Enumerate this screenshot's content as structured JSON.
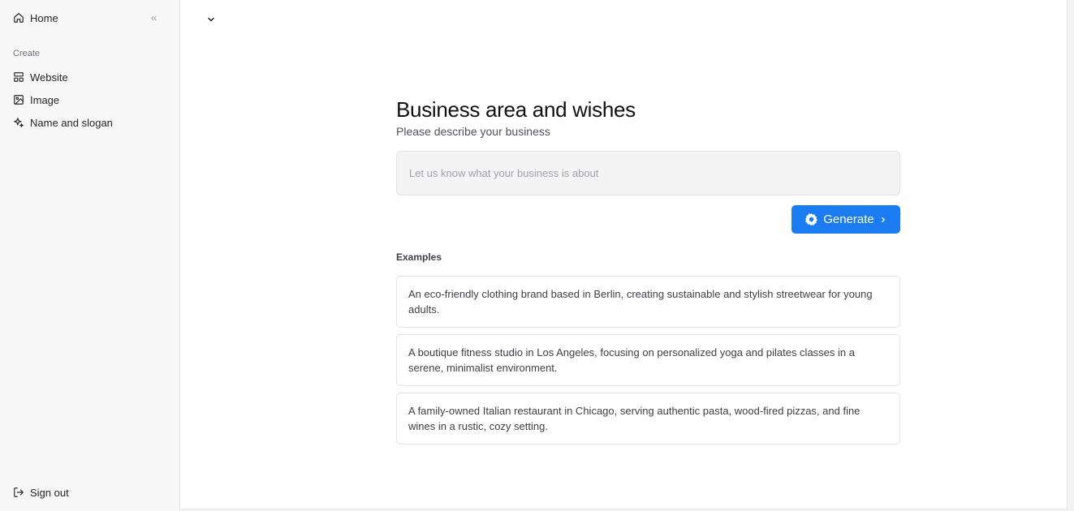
{
  "sidebar": {
    "home_label": "Home",
    "section_label": "Create",
    "items": [
      {
        "label": "Website",
        "icon": "layout-icon"
      },
      {
        "label": "Image",
        "icon": "image-icon"
      },
      {
        "label": "Name and slogan",
        "icon": "sparkle-icon"
      }
    ],
    "sign_out_label": "Sign out"
  },
  "main": {
    "title": "Business area and wishes",
    "subtitle": "Please describe your business",
    "input": {
      "value": "",
      "placeholder": "Let us know what your business is about"
    },
    "generate_label": "Generate",
    "examples_label": "Examples",
    "examples": [
      "An eco-friendly clothing brand based in Berlin, creating sustainable and stylish streetwear for young adults.",
      "A boutique fitness studio in Los Angeles, focusing on personalized yoga and pilates classes in a serene, minimalist environment.",
      "A family-owned Italian restaurant in Chicago, serving authentic pasta, wood-fired pizzas, and fine wines in a rustic, cozy setting."
    ]
  },
  "colors": {
    "accent": "#1a7cf0",
    "sidebar_bg": "#f7f7f8",
    "main_bg": "#ffffff"
  }
}
